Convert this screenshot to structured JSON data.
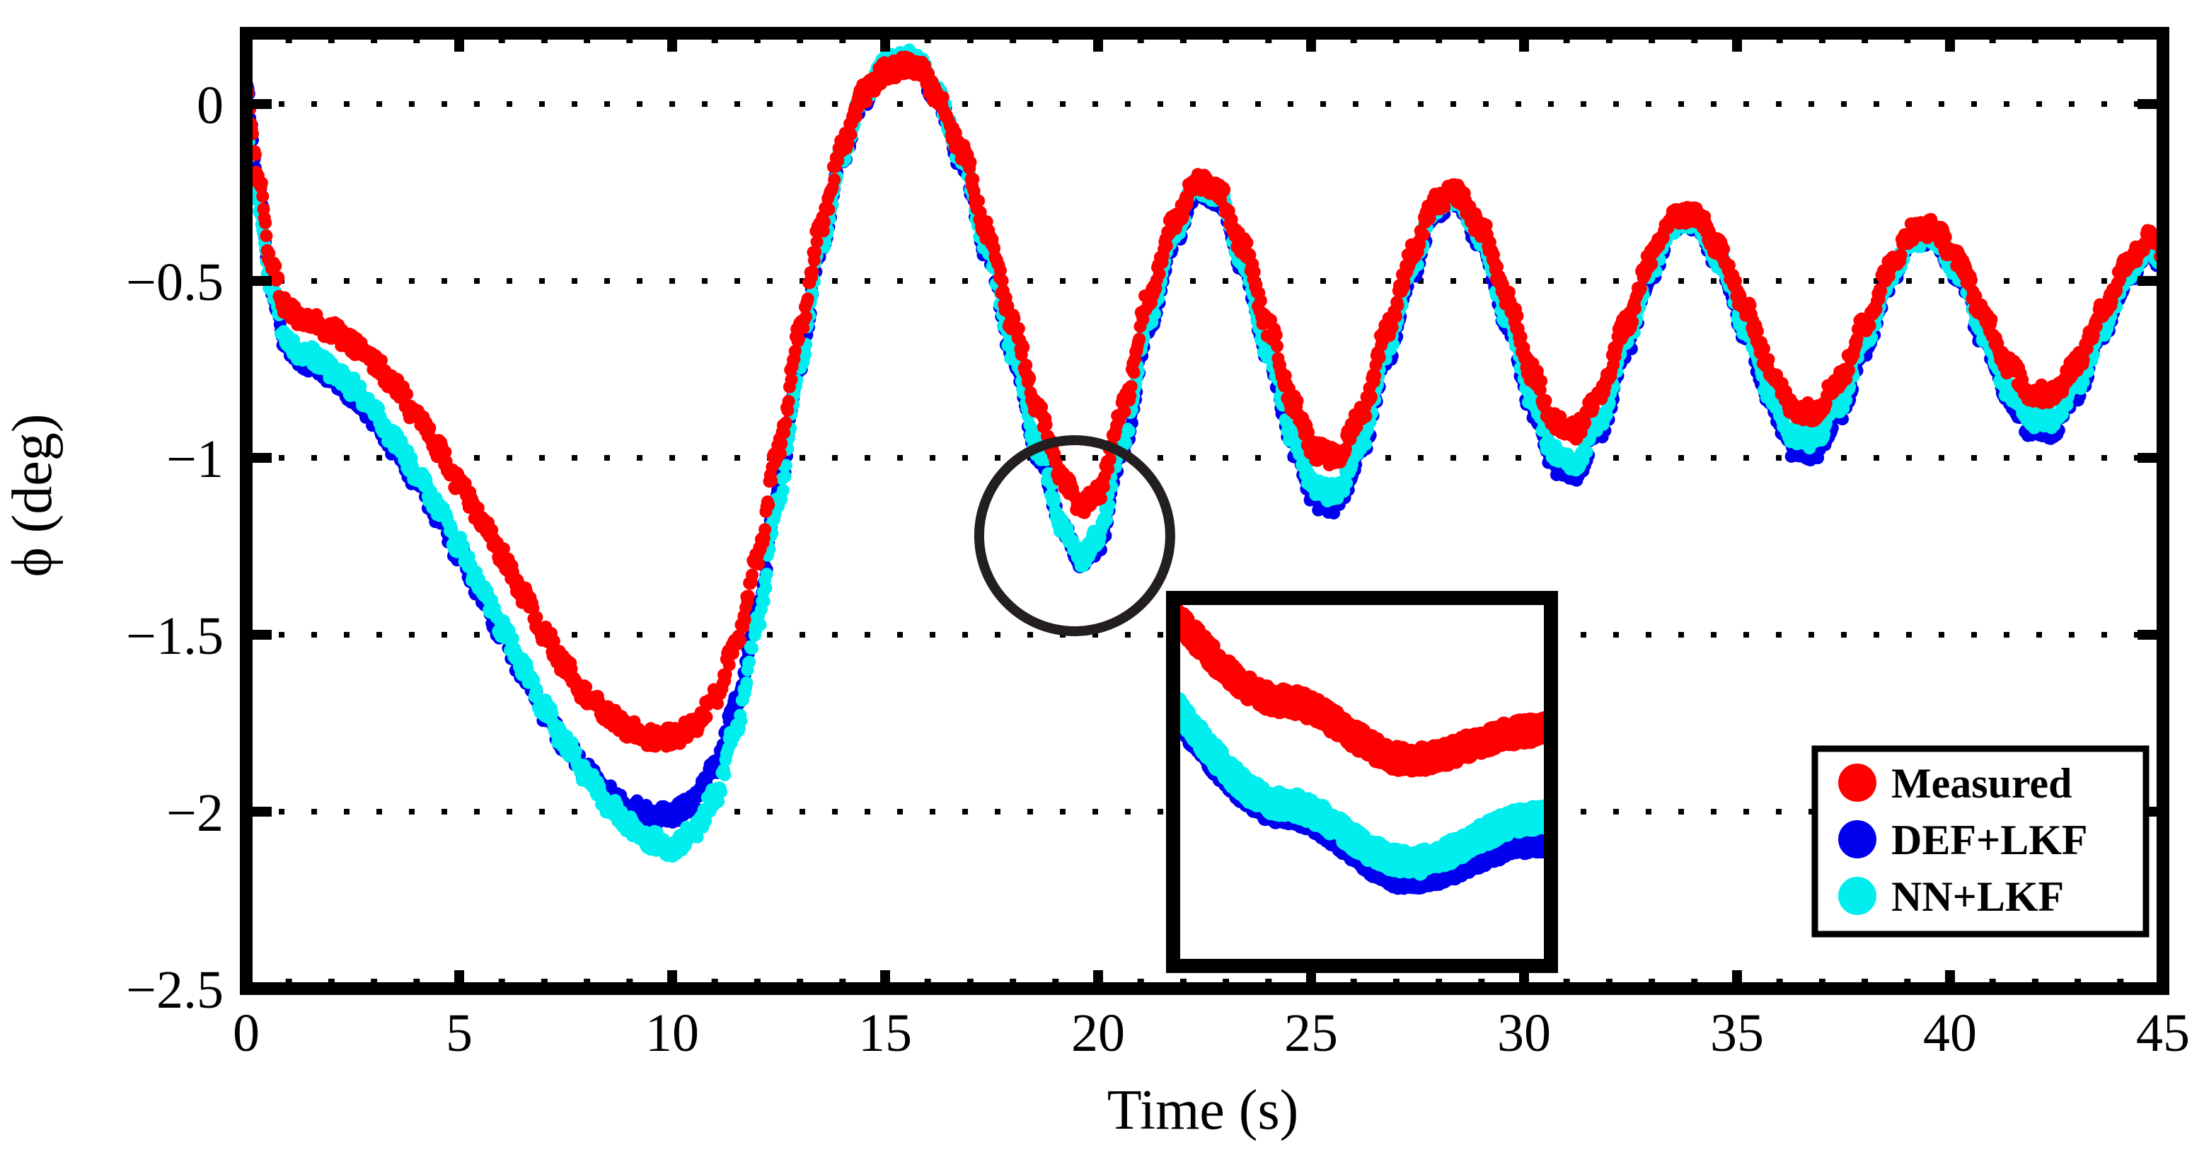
{
  "chart_data": {
    "type": "scatter",
    "title": "",
    "xlabel": "Time (s)",
    "ylabel": "ϕ (deg)",
    "xlim": [
      0,
      45
    ],
    "ylim": [
      -2.5,
      0.2
    ],
    "xticks": [
      "0",
      "5",
      "10",
      "15",
      "20",
      "25",
      "30",
      "35",
      "40",
      "45"
    ],
    "xtick_values": [
      0,
      5,
      10,
      15,
      20,
      25,
      30,
      35,
      40,
      45
    ],
    "yticks": [
      "0",
      "−0.5",
      "−1",
      "−1.5",
      "−2",
      "−2.5"
    ],
    "ytick_values": [
      0,
      -0.5,
      -1,
      -1.5,
      -2,
      -2.5
    ],
    "grid": "horizontal-dotted",
    "legend_position": "lower-right",
    "series": [
      {
        "name": "Measured",
        "color": "#ff0000",
        "marker": "circle",
        "offset": 0.0,
        "x": [
          0.0,
          0.3,
          0.6,
          0.9,
          1.2,
          1.5,
          2.0,
          2.5,
          3.0,
          3.5,
          4.0,
          4.5,
          5.0,
          5.5,
          6.0,
          6.5,
          7.0,
          7.5,
          8.0,
          8.5,
          9.0,
          9.5,
          10.0,
          10.5,
          11.0,
          11.5,
          12.0,
          12.5,
          13.0,
          13.5,
          14.0,
          14.5,
          15.0,
          15.5,
          15.8,
          16.2,
          16.8,
          17.4,
          18.0,
          18.6,
          19.2,
          19.6,
          20.0,
          20.6,
          21.2,
          21.8,
          22.3,
          22.8,
          23.4,
          24.0,
          24.6,
          25.1,
          25.6,
          26.2,
          26.8,
          27.4,
          27.9,
          28.4,
          29.0,
          29.6,
          30.2,
          30.7,
          31.2,
          31.8,
          32.4,
          33.0,
          33.5,
          34.0,
          34.6,
          35.2,
          35.8,
          36.3,
          36.8,
          37.4,
          38.0,
          38.6,
          39.1,
          39.6,
          40.2,
          40.8,
          41.4,
          41.9,
          42.4,
          43.0,
          43.6,
          44.2,
          44.7,
          45.0
        ],
        "y": [
          0.03,
          -0.22,
          -0.46,
          -0.57,
          -0.6,
          -0.61,
          -0.64,
          -0.68,
          -0.73,
          -0.8,
          -0.88,
          -0.97,
          -1.07,
          -1.17,
          -1.28,
          -1.39,
          -1.5,
          -1.59,
          -1.67,
          -1.73,
          -1.77,
          -1.79,
          -1.79,
          -1.76,
          -1.68,
          -1.52,
          -1.28,
          -0.97,
          -0.64,
          -0.34,
          -0.11,
          0.03,
          0.09,
          0.11,
          0.1,
          0.03,
          -0.13,
          -0.36,
          -0.62,
          -0.87,
          -1.06,
          -1.14,
          -1.1,
          -0.85,
          -0.54,
          -0.33,
          -0.22,
          -0.24,
          -0.4,
          -0.63,
          -0.85,
          -0.98,
          -1.0,
          -0.87,
          -0.63,
          -0.42,
          -0.28,
          -0.25,
          -0.35,
          -0.55,
          -0.76,
          -0.9,
          -0.92,
          -0.82,
          -0.62,
          -0.43,
          -0.32,
          -0.31,
          -0.41,
          -0.58,
          -0.75,
          -0.86,
          -0.87,
          -0.78,
          -0.62,
          -0.46,
          -0.36,
          -0.35,
          -0.44,
          -0.6,
          -0.74,
          -0.82,
          -0.82,
          -0.73,
          -0.58,
          -0.44,
          -0.38,
          -0.41,
          -0.52
        ]
      },
      {
        "name": "DEF+LKF",
        "color": "#0000ee",
        "marker": "circle",
        "offset": -0.22,
        "x": [
          0.0,
          0.3,
          0.6,
          0.9,
          1.2,
          1.5,
          2.0,
          2.5,
          3.0,
          3.5,
          4.0,
          4.5,
          5.0,
          5.5,
          6.0,
          6.5,
          7.0,
          7.5,
          8.0,
          8.5,
          9.0,
          9.5,
          10.0,
          10.5,
          11.0,
          11.5,
          12.0,
          12.5,
          13.0,
          13.5,
          14.0,
          14.5,
          15.0,
          15.5,
          15.8,
          16.2,
          16.8,
          17.4,
          18.0,
          18.6,
          19.2,
          19.6,
          20.0,
          20.6,
          21.2,
          21.8,
          22.3,
          22.8,
          23.4,
          24.0,
          24.6,
          25.1,
          25.6,
          26.2,
          26.8,
          27.4,
          27.9,
          28.4,
          29.0,
          29.6,
          30.2,
          30.7,
          31.2,
          31.8,
          32.4,
          33.0,
          33.5,
          34.0,
          34.6,
          35.2,
          35.8,
          36.3,
          36.8,
          37.4,
          38.0,
          38.6,
          39.1,
          39.6,
          40.2,
          40.8,
          41.4,
          41.9,
          42.4,
          43.0,
          43.6,
          44.2,
          44.7,
          45.0
        ],
        "y": [
          0.04,
          -0.24,
          -0.52,
          -0.68,
          -0.72,
          -0.73,
          -0.77,
          -0.82,
          -0.89,
          -0.97,
          -1.06,
          -1.16,
          -1.27,
          -1.38,
          -1.5,
          -1.61,
          -1.72,
          -1.81,
          -1.89,
          -1.95,
          -1.99,
          -2.01,
          -2.01,
          -1.97,
          -1.88,
          -1.7,
          -1.43,
          -1.09,
          -0.73,
          -0.4,
          -0.15,
          0.02,
          0.1,
          0.12,
          0.1,
          0.02,
          -0.16,
          -0.42,
          -0.71,
          -0.99,
          -1.21,
          -1.3,
          -1.25,
          -0.97,
          -0.62,
          -0.38,
          -0.24,
          -0.26,
          -0.45,
          -0.72,
          -0.97,
          -1.12,
          -1.13,
          -0.98,
          -0.71,
          -0.47,
          -0.3,
          -0.27,
          -0.39,
          -0.62,
          -0.86,
          -1.02,
          -1.04,
          -0.92,
          -0.69,
          -0.47,
          -0.34,
          -0.33,
          -0.45,
          -0.65,
          -0.85,
          -0.97,
          -0.98,
          -0.88,
          -0.69,
          -0.5,
          -0.38,
          -0.37,
          -0.48,
          -0.67,
          -0.83,
          -0.92,
          -0.92,
          -0.81,
          -0.64,
          -0.48,
          -0.41,
          -0.45,
          -0.58
        ]
      },
      {
        "name": "NN+LKF",
        "color": "#00eeee",
        "marker": "circle",
        "offset": -0.2,
        "x": [
          0.0,
          0.3,
          0.6,
          0.9,
          1.2,
          1.5,
          2.0,
          2.5,
          3.0,
          3.5,
          4.0,
          4.5,
          5.0,
          5.5,
          6.0,
          6.5,
          7.0,
          7.5,
          8.0,
          8.5,
          9.0,
          9.5,
          10.0,
          10.5,
          11.0,
          11.5,
          12.0,
          12.5,
          13.0,
          13.5,
          14.0,
          14.5,
          15.0,
          15.5,
          15.8,
          16.2,
          16.8,
          17.4,
          18.0,
          18.6,
          19.2,
          19.6,
          20.0,
          20.6,
          21.2,
          21.8,
          22.3,
          22.8,
          23.4,
          24.0,
          24.6,
          25.1,
          25.6,
          26.2,
          26.8,
          27.4,
          27.9,
          28.4,
          29.0,
          29.6,
          30.2,
          30.7,
          31.2,
          31.8,
          32.4,
          33.0,
          33.5,
          34.0,
          34.6,
          35.2,
          35.8,
          36.3,
          36.8,
          37.4,
          38.0,
          38.6,
          39.1,
          39.6,
          40.2,
          40.8,
          41.4,
          41.9,
          42.4,
          43.0,
          43.6,
          44.2,
          44.7,
          45.0
        ],
        "y": [
          -0.1,
          -0.3,
          -0.52,
          -0.65,
          -0.7,
          -0.71,
          -0.75,
          -0.8,
          -0.87,
          -0.95,
          -1.04,
          -1.14,
          -1.25,
          -1.36,
          -1.48,
          -1.59,
          -1.71,
          -1.81,
          -1.9,
          -1.98,
          -2.04,
          -2.08,
          -2.1,
          -2.06,
          -1.96,
          -1.76,
          -1.47,
          -1.11,
          -0.74,
          -0.4,
          -0.14,
          0.03,
          0.11,
          0.13,
          0.11,
          0.03,
          -0.15,
          -0.41,
          -0.7,
          -0.98,
          -1.2,
          -1.28,
          -1.22,
          -0.94,
          -0.6,
          -0.36,
          -0.23,
          -0.25,
          -0.44,
          -0.7,
          -0.95,
          -1.09,
          -1.1,
          -0.95,
          -0.69,
          -0.45,
          -0.29,
          -0.26,
          -0.38,
          -0.6,
          -0.84,
          -0.99,
          -1.01,
          -0.89,
          -0.67,
          -0.46,
          -0.34,
          -0.33,
          -0.44,
          -0.63,
          -0.82,
          -0.94,
          -0.95,
          -0.85,
          -0.67,
          -0.49,
          -0.38,
          -0.37,
          -0.47,
          -0.65,
          -0.81,
          -0.89,
          -0.89,
          -0.79,
          -0.63,
          -0.47,
          -0.41,
          -0.44,
          -0.56
        ]
      }
    ],
    "annotations": {
      "callout_circle": {
        "center_x": 19.45,
        "center_y": -1.22,
        "radius_px": 135
      },
      "inset_box": {
        "x1": 1658,
        "y1": 845,
        "x2": 2192,
        "y2": 1365
      },
      "connector": {
        "from_x": 1772,
        "from_y": 1015,
        "to_x": 1940,
        "to_y": 1095
      }
    }
  },
  "legend": {
    "items": [
      {
        "label": "Measured",
        "color": "#ff0000"
      },
      {
        "label": "DEF+LKF",
        "color": "#0000ee"
      },
      {
        "label": "NN+LKF",
        "color": "#00eeee"
      }
    ]
  },
  "axes": {
    "x_title": "Time (s)",
    "y_title": "ϕ (deg)",
    "x_tick_labels": [
      "0",
      "5",
      "10",
      "15",
      "20",
      "25",
      "30",
      "35",
      "40",
      "45"
    ],
    "y_tick_labels": [
      "0",
      "−0.5",
      "−1",
      "−1.5",
      "−2",
      "−2.5"
    ]
  }
}
